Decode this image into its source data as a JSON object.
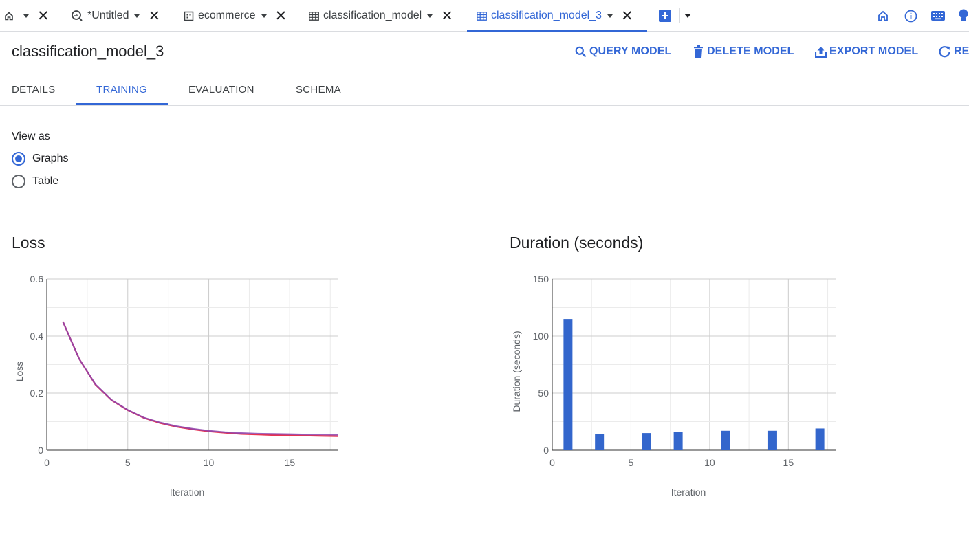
{
  "tabs": [
    {
      "label": "",
      "icon": "home-icon",
      "has_caret": true,
      "closable": true
    },
    {
      "label": "*Untitled",
      "icon": "query-icon",
      "has_caret": true,
      "closable": true
    },
    {
      "label": "ecommerce",
      "icon": "dataset-icon",
      "has_caret": true,
      "closable": true
    },
    {
      "label": "classification_model",
      "icon": "model-icon",
      "has_caret": true,
      "closable": true
    },
    {
      "label": "classification_model_3",
      "icon": "model-icon",
      "has_caret": true,
      "closable": true,
      "active": true
    }
  ],
  "top_icons": [
    "home-icon",
    "info-icon",
    "keyboard-icon",
    "lightbulb-icon"
  ],
  "header": {
    "title": "classification_model_3",
    "actions": {
      "query": "QUERY MODEL",
      "delete": "DELETE MODEL",
      "export": "EXPORT MODEL",
      "refresh": "RE"
    }
  },
  "subtabs": {
    "details": "DETAILS",
    "training": "TRAINING",
    "evaluation": "EVALUATION",
    "schema": "SCHEMA",
    "active": "TRAINING"
  },
  "view_as": {
    "label": "View as",
    "options": [
      "Graphs",
      "Table"
    ],
    "selected": "Graphs"
  },
  "colors": {
    "accent": "#3367d6",
    "loss_train": "#e8334f",
    "loss_eval": "#8e44ad",
    "duration_bar": "#3366cc"
  },
  "chart_data": [
    {
      "type": "line",
      "title": "Loss",
      "xlabel": "Iteration",
      "ylabel": "Loss",
      "xlim": [
        0,
        18
      ],
      "ylim": [
        0,
        0.6
      ],
      "xticks": [
        0,
        5,
        10,
        15
      ],
      "yticks": [
        0,
        0.2,
        0.4,
        0.6
      ],
      "ytick_labels": [
        "0",
        "0.2",
        "0.4",
        "0.6"
      ],
      "grid": true,
      "x": [
        1,
        2,
        3,
        4,
        5,
        6,
        7,
        8,
        9,
        10,
        11,
        12,
        13,
        14,
        15,
        16,
        17,
        18
      ],
      "series": [
        {
          "values": [
            0.45,
            0.32,
            0.23,
            0.175,
            0.14,
            0.113,
            0.095,
            0.082,
            0.073,
            0.066,
            0.061,
            0.057,
            0.055,
            0.053,
            0.052,
            0.051,
            0.05,
            0.049
          ]
        },
        {
          "values": [
            0.45,
            0.32,
            0.231,
            0.176,
            0.141,
            0.114,
            0.097,
            0.084,
            0.075,
            0.068,
            0.063,
            0.06,
            0.058,
            0.057,
            0.056,
            0.055,
            0.055,
            0.054
          ]
        }
      ]
    },
    {
      "type": "bar",
      "title": "Duration (seconds)",
      "xlabel": "Iteration",
      "ylabel": "Duration (seconds)",
      "xlim": [
        0,
        18
      ],
      "ylim": [
        0,
        150
      ],
      "xticks": [
        0,
        5,
        10,
        15
      ],
      "yticks": [
        0,
        50,
        100,
        150
      ],
      "grid": true,
      "x": [
        1,
        3,
        6,
        8,
        11,
        14,
        17
      ],
      "values": [
        115,
        14,
        15,
        16,
        17,
        17,
        19
      ]
    }
  ]
}
